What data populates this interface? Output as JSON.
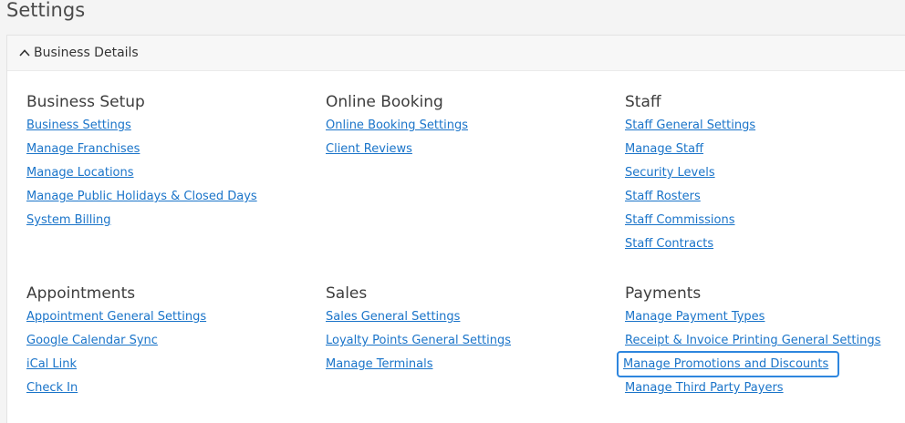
{
  "page": {
    "title": "Settings"
  },
  "panel": {
    "header_label": "Business Details",
    "expanded": true
  },
  "sections": [
    {
      "title": "Business Setup",
      "links": [
        "Business Settings",
        "Manage Franchises",
        "Manage Locations",
        "Manage Public Holidays & Closed Days",
        "System Billing"
      ]
    },
    {
      "title": "Online Booking",
      "links": [
        "Online Booking Settings",
        "Client Reviews"
      ]
    },
    {
      "title": "Staff",
      "links": [
        "Staff General Settings",
        "Manage Staff",
        "Security Levels",
        "Staff Rosters",
        "Staff Commissions",
        "Staff Contracts"
      ]
    },
    {
      "title": "Appointments",
      "links": [
        "Appointment General Settings",
        "Google Calendar Sync",
        "iCal Link",
        "Check In"
      ]
    },
    {
      "title": "Sales",
      "links": [
        "Sales General Settings",
        "Loyalty Points General Settings",
        "Manage Terminals"
      ]
    },
    {
      "title": "Payments",
      "links": [
        "Manage Payment Types",
        "Receipt & Invoice Printing General Settings",
        "Manage Promotions and Discounts",
        "Manage Third Party Payers"
      ]
    }
  ],
  "highlighted_link": "Manage Promotions and Discounts",
  "colors": {
    "link": "#1a74c9",
    "highlight_border": "#2e86de",
    "background": "#f4f4f4"
  }
}
